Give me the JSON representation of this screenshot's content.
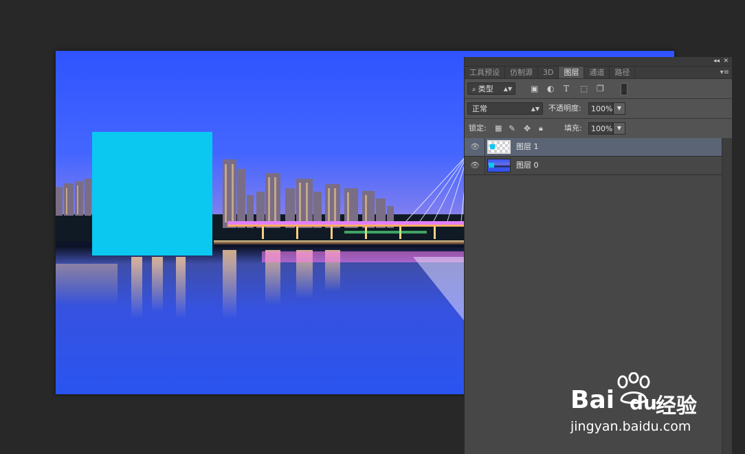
{
  "panel": {
    "collapse_icon": "double-chevron-left-icon",
    "close_icon": "close-icon",
    "tabs": [
      {
        "label": "工具预设",
        "active": false
      },
      {
        "label": "仿制源",
        "active": false
      },
      {
        "label": "3D",
        "active": false
      },
      {
        "label": "图层",
        "active": true
      },
      {
        "label": "通道",
        "active": false
      },
      {
        "label": "路径",
        "active": false
      }
    ],
    "filter": {
      "kind_label": "类型",
      "icons": [
        "image-filter-icon",
        "adjustment-filter-icon",
        "type-filter-icon",
        "shape-filter-icon",
        "smart-object-filter-icon"
      ]
    },
    "blend": {
      "mode": "正常",
      "opacity_label": "不透明度:",
      "opacity_value": "100%"
    },
    "lock": {
      "label": "锁定:",
      "icons": [
        "lock-transparent-icon",
        "lock-paint-icon",
        "lock-position-icon",
        "lock-all-icon"
      ],
      "fill_label": "填充:",
      "fill_value": "100%"
    },
    "layers": [
      {
        "name": "图层 1",
        "selected": true,
        "visible": true,
        "thumb": "transparent"
      },
      {
        "name": "图层 0",
        "selected": false,
        "visible": true,
        "thumb": "city-photo"
      }
    ]
  },
  "canvas": {
    "content": "city-night-skyline-photo",
    "overlay_color": "#0ac8f0"
  },
  "watermark": {
    "brand": "Bai",
    "brand_tail": "du",
    "suffix": "经验",
    "url": "jingyan.baidu.com"
  },
  "colors": {
    "selected_layer": "#5a6475",
    "panel_bg": "#474747",
    "app_bg": "#282828"
  }
}
